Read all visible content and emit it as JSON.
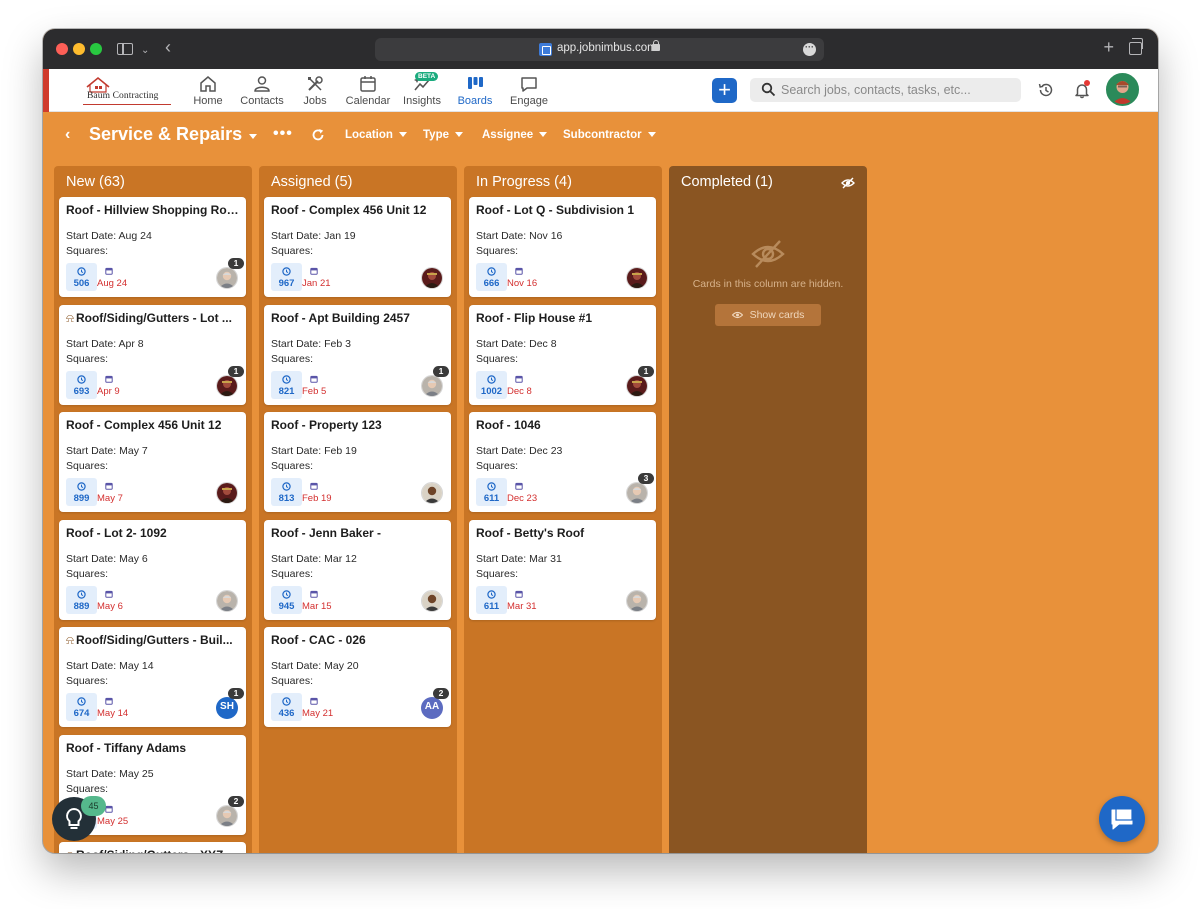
{
  "browser": {
    "url": "app.jobnimbus.com"
  },
  "app": {
    "logo_text": "Baum Contracting",
    "nav": [
      {
        "label": "Home",
        "icon": "home-icon"
      },
      {
        "label": "Contacts",
        "icon": "person-icon"
      },
      {
        "label": "Jobs",
        "icon": "tools-icon"
      },
      {
        "label": "Calendar",
        "icon": "calendar-icon"
      },
      {
        "label": "Insights",
        "icon": "sparkle-chart-icon",
        "badge": "BETA"
      },
      {
        "label": "Boards",
        "icon": "boards-icon",
        "active": true
      },
      {
        "label": "Engage",
        "icon": "chat-bubble-icon"
      }
    ],
    "add_label": "+",
    "search_placeholder": "Search jobs, contacts, tasks, etc...",
    "accent_color": "#1f68c7",
    "board_bg_color": "#e8913a"
  },
  "toolbar": {
    "back_label": "‹",
    "board_title": "Service & Repairs",
    "more_label": "•••",
    "filters": [
      "Location",
      "Type",
      "Assignee",
      "Subcontractor"
    ]
  },
  "columns": [
    {
      "title": "New (63)",
      "cards": [
        {
          "title": "Roof - Hillview Shopping Roo...",
          "start": "Start Date: Aug 24",
          "squares": "Squares:",
          "metric": "506",
          "due": "Aug 24",
          "badge": "1",
          "avatar": "gray"
        },
        {
          "title": "Roof/Siding/Gutters - Lot ...",
          "ladder": true,
          "start": "Start Date: Apr 8",
          "squares": "Squares:",
          "metric": "693",
          "due": "Apr 9",
          "badge": "1",
          "avatar": "dark"
        },
        {
          "title": "Roof - Complex 456 Unit 12",
          "start": "Start Date: May 7",
          "squares": "Squares:",
          "metric": "899",
          "due": "May 7",
          "badge": "",
          "avatar": "dark"
        },
        {
          "title": "Roof - Lot 2- 1092",
          "start": "Start Date: May 6",
          "squares": "Squares:",
          "metric": "889",
          "due": "May 6",
          "badge": "",
          "avatar": "gray"
        },
        {
          "title": "Roof/Siding/Gutters - Buil...",
          "ladder": true,
          "start": "Start Date: May 14",
          "squares": "Squares:",
          "metric": "674",
          "due": "May 14",
          "badge": "1",
          "avatar": "initials",
          "initials": "SH",
          "initials_color": "#1f68c7"
        },
        {
          "title": "Roof - Tiffany Adams",
          "start": "Start Date: May 25",
          "squares": "Squares:",
          "metric": "",
          "due": "May 25",
          "badge": "2",
          "avatar": "gray"
        },
        {
          "title": "Roof/Siding/Gutters - XYZ",
          "ladder": true,
          "start": "",
          "squares": "",
          "metric": "",
          "due": "",
          "badge": "",
          "avatar": "none"
        }
      ]
    },
    {
      "title": "Assigned (5)",
      "cards": [
        {
          "title": "Roof - Complex 456 Unit 12",
          "start": "Start Date: Jan 19",
          "squares": "Squares:",
          "metric": "967",
          "due": "Jan 21",
          "badge": "",
          "avatar": "dark"
        },
        {
          "title": "Roof - Apt Building 2457",
          "start": "Start Date: Feb 3",
          "squares": "Squares:",
          "metric": "821",
          "due": "Feb 5",
          "badge": "1",
          "avatar": "gray"
        },
        {
          "title": "Roof - Property 123",
          "start": "Start Date: Feb 19",
          "squares": "Squares:",
          "metric": "813",
          "due": "Feb 19",
          "badge": "",
          "avatar": "brown"
        },
        {
          "title": "Roof - Jenn Baker -",
          "start": "Start Date: Mar 12",
          "squares": "Squares:",
          "metric": "945",
          "due": "Mar 15",
          "badge": "",
          "avatar": "brown"
        },
        {
          "title": "Roof - CAC - 026",
          "start": "Start Date: May 20",
          "squares": "Squares:",
          "metric": "436",
          "due": "May 21",
          "badge": "2",
          "avatar": "initials",
          "initials": "AA",
          "initials_color": "#5c6bc0"
        }
      ]
    },
    {
      "title": "In Progress (4)",
      "cards": [
        {
          "title": "Roof - Lot Q - Subdivision 1",
          "start": "Start Date: Nov 16",
          "squares": "Squares:",
          "metric": "666",
          "due": "Nov 16",
          "badge": "",
          "avatar": "dark"
        },
        {
          "title": "Roof - Flip House #1",
          "start": "Start Date: Dec 8",
          "squares": "Squares:",
          "metric": "1002",
          "due": "Dec 8",
          "badge": "1",
          "avatar": "dark"
        },
        {
          "title": "Roof - 1046",
          "start": "Start Date: Dec 23",
          "squares": "Squares:",
          "metric": "611",
          "due": "Dec 23",
          "badge": "3",
          "avatar": "gray"
        },
        {
          "title": "Roof - Betty's Roof",
          "start": "Start Date: Mar 31",
          "squares": "Squares:",
          "metric": "611",
          "due": "Mar 31",
          "badge": "",
          "avatar": "gray"
        }
      ]
    },
    {
      "title": "Completed (1)",
      "hidden": true,
      "hidden_text": "Cards in this column are hidden.",
      "show_cards_label": "Show cards",
      "cards": []
    }
  ],
  "floating": {
    "tips_count": "45"
  }
}
